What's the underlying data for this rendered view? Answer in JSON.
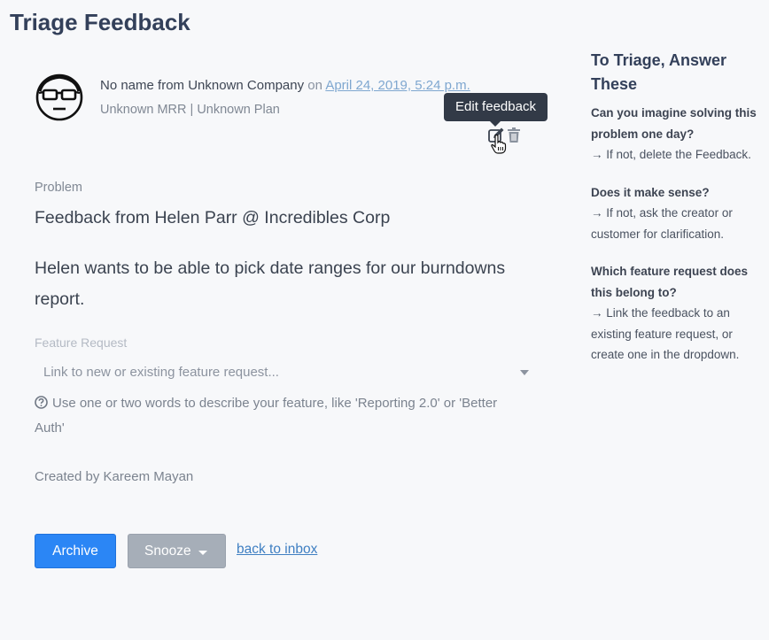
{
  "page": {
    "title": "Triage Feedback"
  },
  "feedback": {
    "author": "No name from Unknown Company",
    "on_word": "on",
    "date": "April 24, 2019, 5:24 p.m.",
    "meta": "Unknown MRR | Unknown Plan",
    "tooltip": "Edit feedback",
    "problem_label": "Problem",
    "problem_title": "Feedback from Helen Parr @ Incredibles Corp",
    "problem_body": "Helen wants to be able to pick date ranges for our burndowns report."
  },
  "feature_request": {
    "label": "Feature Request",
    "placeholder": "Link to new or existing feature request...",
    "help": "Use one or two words to describe your feature, like 'Reporting 2.0' or 'Better Auth'"
  },
  "created_by": "Created by Kareem Mayan",
  "actions": {
    "archive": "Archive",
    "snooze": "Snooze",
    "back": "back to inbox"
  },
  "sidebar": {
    "title": "To Triage, Answer These",
    "items": [
      {
        "question": "Can you imagine solving this problem one day?",
        "answer": "→ If not, delete the Feedback."
      },
      {
        "question": "Does it make sense?",
        "answer": "→ If not, ask the creator or customer for clarification."
      },
      {
        "question": "Which feature request does this belong to?",
        "answer": "→ Link the feedback to an existing feature request, or create one in the dropdown."
      }
    ]
  },
  "colors": {
    "primary": "#2b86f5",
    "secondary": "#a6aeb8",
    "link": "#3f7fc2",
    "heading": "#33405a"
  },
  "icons": [
    "nerd-avatar-icon",
    "edit-icon",
    "trash-icon",
    "hand-cursor-icon",
    "help-circle-icon",
    "caret-down-icon"
  ]
}
